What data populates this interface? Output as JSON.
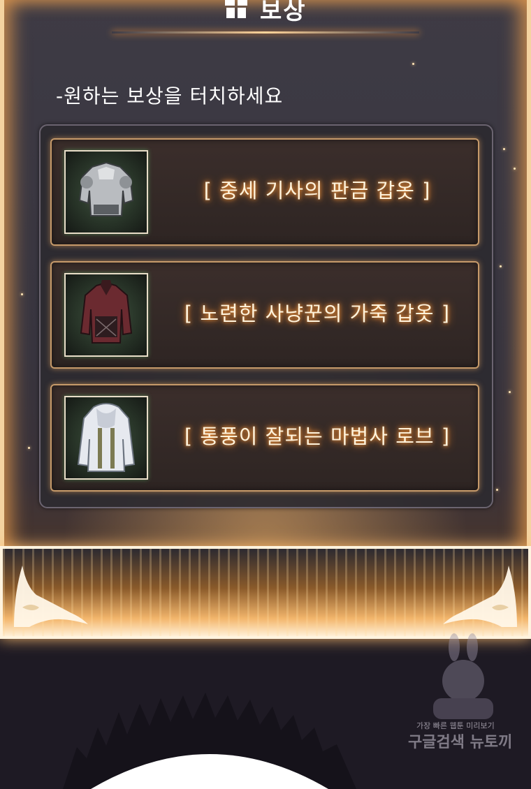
{
  "header": {
    "title": "보상",
    "icon": "gift-icon"
  },
  "instruction": "-원하는 보상을 터치하세요",
  "rewards": [
    {
      "label": "[ 중세 기사의 판금 갑옷 ]",
      "icon": "plate-armor-icon"
    },
    {
      "label": "[ 노련한 사냥꾼의 가죽 갑옷 ]",
      "icon": "leather-armor-icon"
    },
    {
      "label": "[ 통풍이 잘되는 마법사 로브 ]",
      "icon": "wizard-robe-icon"
    }
  ],
  "watermark": {
    "line1": "가장 빠른 웹툰 미리보기",
    "line2": "구글검색 뉴토끼"
  },
  "colors": {
    "glow": "#ff9c3c",
    "frame": "#f4d3a0",
    "item_border": "#c69a6a",
    "label": "#fff3dc"
  }
}
